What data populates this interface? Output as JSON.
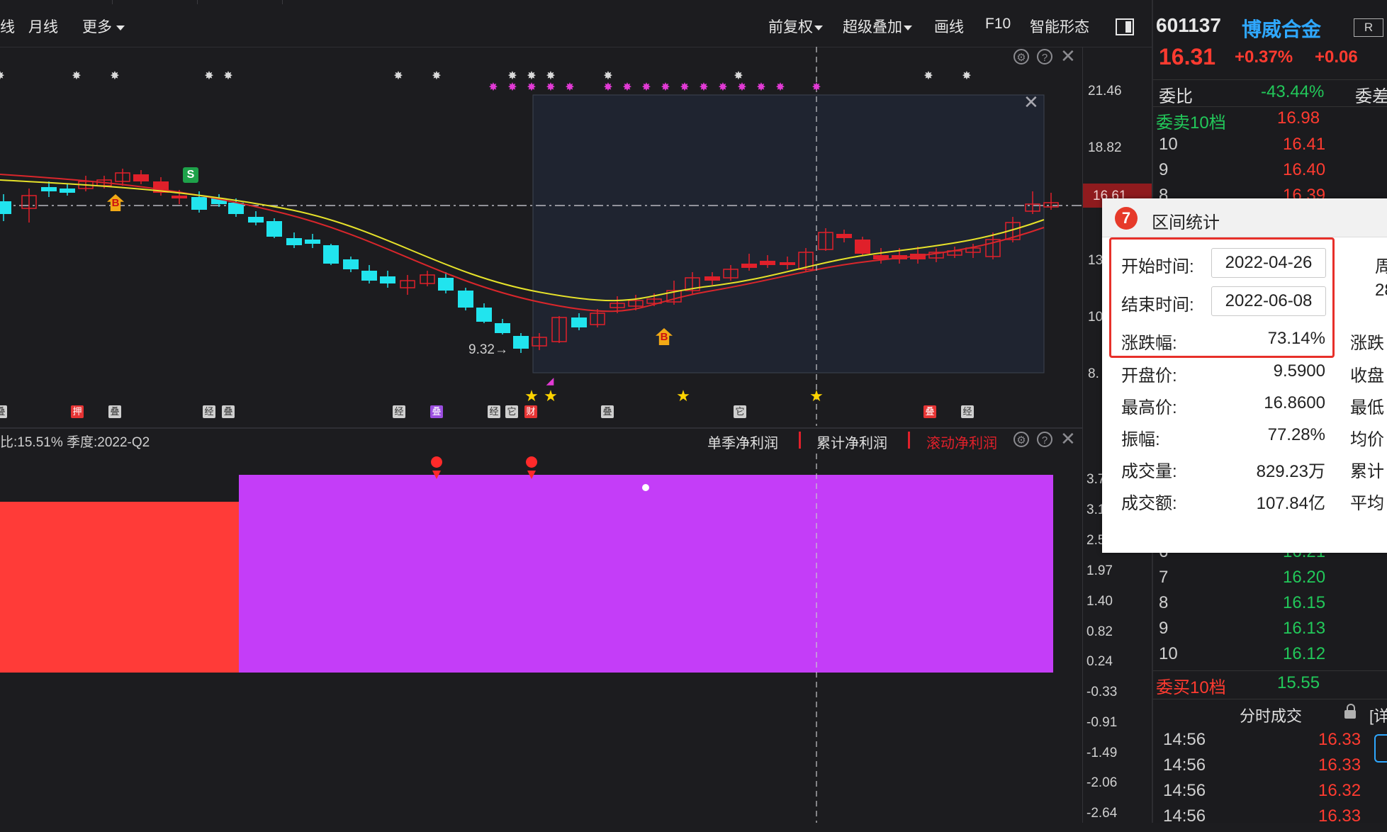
{
  "toolbar": {
    "left_items": [
      "线",
      "月线",
      "更多"
    ],
    "right_items": [
      "前复权",
      "超级叠加",
      "画线",
      "F10",
      "智能形态"
    ]
  },
  "price_axis": {
    "labels": [
      "21.46",
      "18.82",
      "16.61",
      "13",
      "10",
      "8."
    ]
  },
  "main_chart": {
    "low_label": "9.32",
    "trade_flags": [
      "S",
      "B",
      "B"
    ],
    "event_tags": [
      "叠",
      "押",
      "叠",
      "经",
      "叠",
      "经",
      "叠",
      "经",
      "它",
      "财",
      "叠",
      "它",
      "叠",
      "经"
    ]
  },
  "lower_panel": {
    "header_left": "比:15.51%  季度:2022-Q2",
    "legend": [
      "单季净利润",
      "累计净利润",
      "滚动净利润"
    ],
    "axis_labels": [
      "3.7",
      "3.1",
      "2.5",
      "1.97",
      "1.40",
      "0.82",
      "0.24",
      "-0.33",
      "-0.91",
      "-1.49",
      "-2.06",
      "-2.64"
    ]
  },
  "quote": {
    "code": "601137",
    "name": "博威合金",
    "badge": "R",
    "price": "16.31",
    "pct": "+0.37%",
    "chg": "+0.06",
    "weibi_label": "委比",
    "weibi_value": "-43.44%",
    "weicha_label": "委差",
    "sell_label": "委卖10档",
    "sell_value": "16.98",
    "sell_rows": [
      {
        "lvl": "10",
        "price": "16.41"
      },
      {
        "lvl": "9",
        "price": "16.40"
      },
      {
        "lvl": "8",
        "price": "16.39"
      }
    ],
    "buy_rows": [
      {
        "lvl": "6",
        "price": "16.21"
      },
      {
        "lvl": "7",
        "price": "16.20"
      },
      {
        "lvl": "8",
        "price": "16.15"
      },
      {
        "lvl": "9",
        "price": "16.13"
      },
      {
        "lvl": "10",
        "price": "16.12"
      }
    ],
    "buy_label": "委买10档",
    "buy_value": "15.55",
    "ticks_title": "分时成交",
    "ticks_more": "[详",
    "ticks": [
      {
        "time": "14:56",
        "price": "16.33"
      },
      {
        "time": "14:56",
        "price": "16.33"
      },
      {
        "time": "14:56",
        "price": "16.32"
      },
      {
        "time": "14:56",
        "price": "16.33"
      }
    ]
  },
  "popup": {
    "title": "区间统计",
    "start_label": "开始时间:",
    "start_value": "2022-04-26",
    "end_label": "结束时间:",
    "end_value": "2022-06-08",
    "change_label": "涨跌幅:",
    "change_value": "73.14%",
    "open_label": "开盘价:",
    "open_value": "9.5900",
    "high_label": "最高价:",
    "high_value": "16.8600",
    "amp_label": "振幅:",
    "amp_value": "77.28%",
    "vol_label": "成交量:",
    "vol_value": "829.23万",
    "amt_label": "成交额:",
    "amt_value": "107.84亿",
    "cut_right": [
      "周",
      "28",
      "涨跌",
      "收盘",
      "最低",
      "均价",
      "累计",
      "平均"
    ]
  },
  "colors": {
    "up": "#e0202a",
    "down": "#21e4ee",
    "ma_yellow": "#e6e22a",
    "ma_red": "#d9262b",
    "purple": "#c43df8",
    "red_block": "#ff3b38"
  }
}
